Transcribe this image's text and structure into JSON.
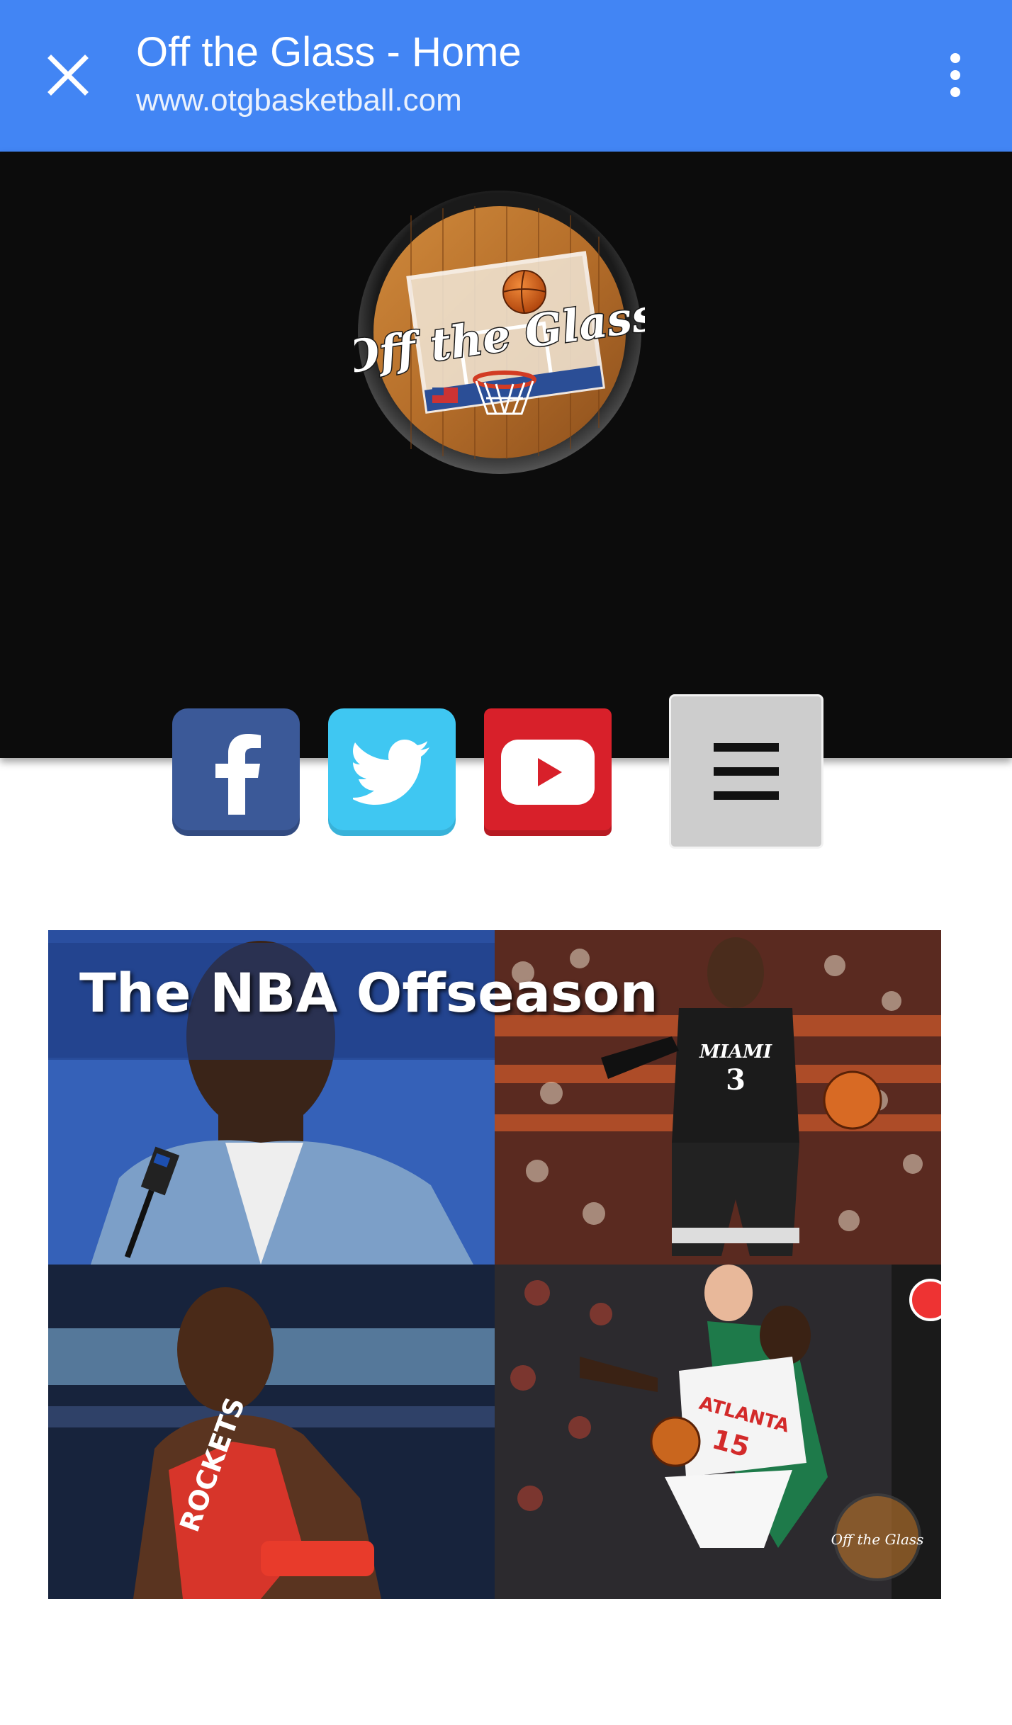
{
  "browser": {
    "title": "Off the Glass - Home",
    "url": "www.otgbasketball.com",
    "close_icon": "close-icon",
    "overflow_icon": "more-vert-icon",
    "bar_color": "#4285f4"
  },
  "site": {
    "logo_text": "Off the Glass",
    "social": [
      {
        "name": "facebook",
        "icon": "facebook-icon",
        "color": "#3b5998"
      },
      {
        "name": "twitter",
        "icon": "twitter-icon",
        "color": "#3fc7f2"
      },
      {
        "name": "youtube",
        "icon": "youtube-icon",
        "color": "#d8202a"
      }
    ],
    "menu_icon": "hamburger-menu-icon"
  },
  "feature": {
    "title": "The NBA Offseason",
    "jersey_texts": [
      "MIAMI",
      "3",
      "ROCKETS",
      "ATLANTA",
      "15"
    ],
    "watermark": "Off the Glass"
  }
}
